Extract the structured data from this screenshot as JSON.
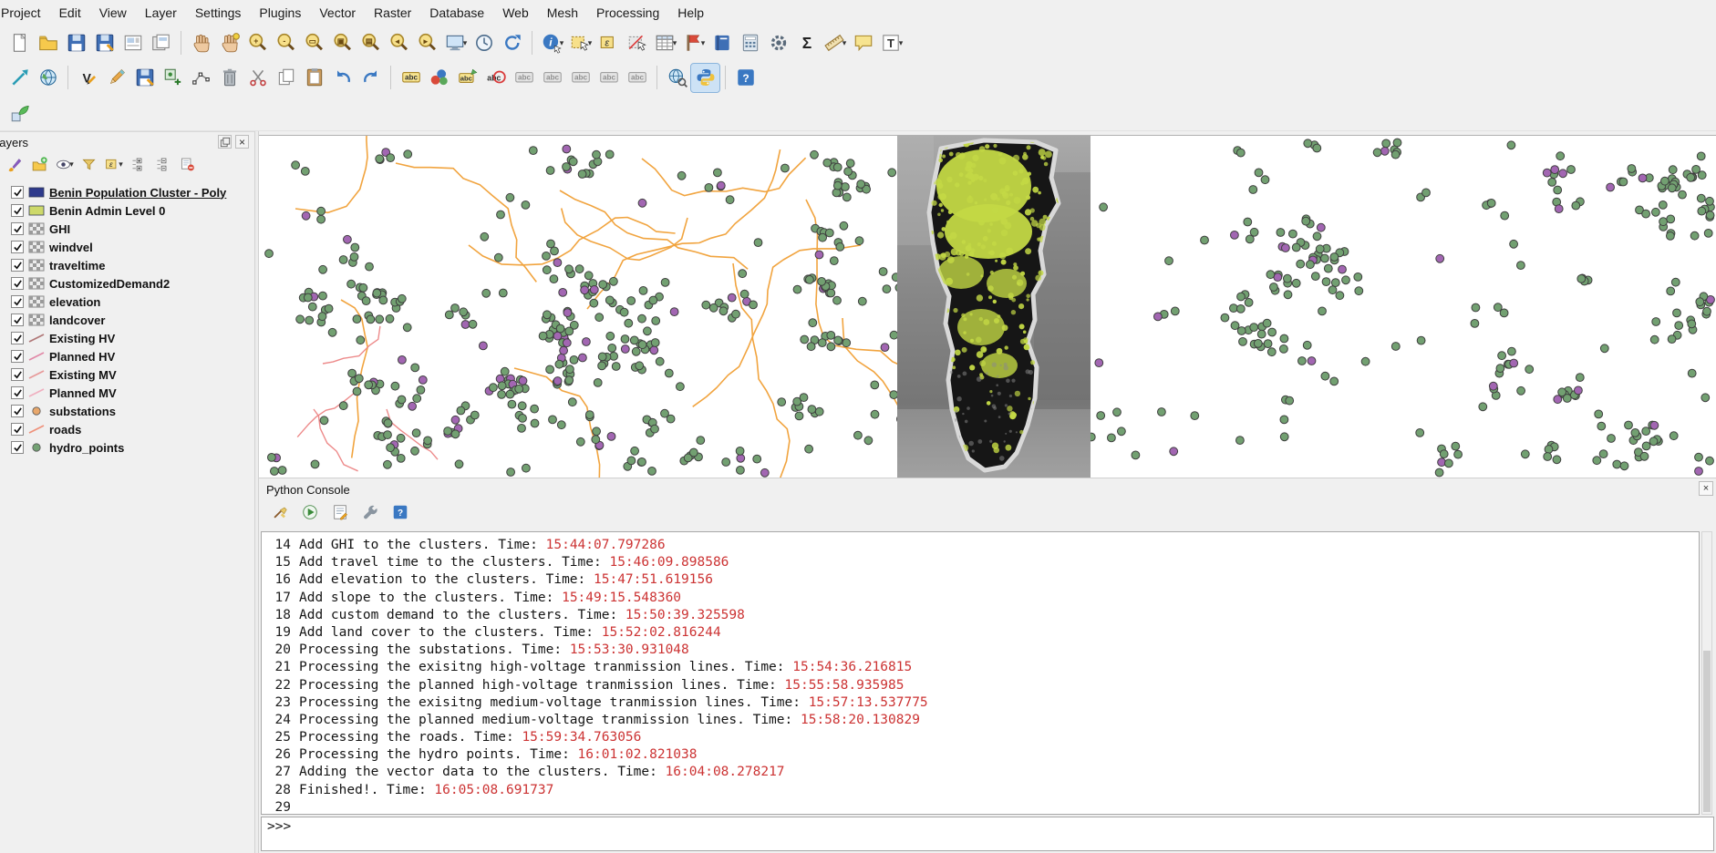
{
  "menu": {
    "items": [
      "Project",
      "Edit",
      "View",
      "Layer",
      "Settings",
      "Plugins",
      "Vector",
      "Raster",
      "Database",
      "Web",
      "Mesh",
      "Processing",
      "Help"
    ]
  },
  "icons": {
    "dropdown": "▾",
    "close": "×",
    "check": "✓"
  },
  "toolbar_main": [
    {
      "name": "new-project",
      "kind": "page"
    },
    {
      "name": "open-project",
      "kind": "folder"
    },
    {
      "name": "save-project",
      "kind": "floppy"
    },
    {
      "name": "save-project-as",
      "kind": "floppy2"
    },
    {
      "name": "new-print-layout",
      "kind": "layout"
    },
    {
      "name": "layout-manager",
      "kind": "layoutmgr"
    },
    {
      "sep": true
    },
    {
      "name": "pan-map",
      "kind": "hand"
    },
    {
      "name": "pan-to-selection",
      "kind": "hand2"
    },
    {
      "name": "zoom-in",
      "kind": "zoom:+"
    },
    {
      "name": "zoom-out",
      "kind": "zoom:-"
    },
    {
      "name": "zoom-full",
      "kind": "zoom:▭"
    },
    {
      "name": "zoom-to-selection",
      "kind": "zoom:▣"
    },
    {
      "name": "zoom-to-layer",
      "kind": "zoom:▤"
    },
    {
      "name": "zoom-last",
      "kind": "zoom:◂"
    },
    {
      "name": "zoom-next",
      "kind": "zoom:▸"
    },
    {
      "name": "new-map-view",
      "kind": "monitor",
      "arrow": true
    },
    {
      "name": "temporal-controller",
      "kind": "clock"
    },
    {
      "name": "refresh-map",
      "kind": "refresh"
    },
    {
      "sep": true
    },
    {
      "name": "identify-features",
      "kind": "info",
      "arrow": true
    },
    {
      "name": "select-features",
      "kind": "cursorbox",
      "arrow": true
    },
    {
      "name": "select-by-expression",
      "kind": "epsilon"
    },
    {
      "name": "deselect-features",
      "kind": "deselect"
    },
    {
      "name": "open-attribute-table",
      "kind": "table",
      "arrow": true
    },
    {
      "name": "new-spatial-bookmark",
      "kind": "flag",
      "arrow": true
    },
    {
      "name": "show-bookmarks",
      "kind": "book"
    },
    {
      "name": "field-calculator",
      "kind": "calc"
    },
    {
      "name": "processing-toolbox",
      "kind": "gear"
    },
    {
      "name": "statistics-summary",
      "kind": "sigma"
    },
    {
      "name": "measure",
      "kind": "ruler",
      "arrow": true
    },
    {
      "name": "map-tips",
      "kind": "bubble"
    },
    {
      "name": "text-annotation",
      "kind": "textT",
      "arrow": true
    }
  ],
  "toolbar_digitizing": [
    {
      "name": "move-feature",
      "kind": "move"
    },
    {
      "name": "georeferencer",
      "kind": "globe"
    },
    {
      "sep": true
    },
    {
      "name": "current-edits",
      "kind": "vpencil"
    },
    {
      "name": "toggle-editing",
      "kind": "pencil"
    },
    {
      "name": "save-layer-edits",
      "kind": "floppy2"
    },
    {
      "name": "add-feature",
      "kind": "addfeat"
    },
    {
      "name": "vertex-tool",
      "kind": "vertex"
    },
    {
      "name": "delete-selected",
      "kind": "trash"
    },
    {
      "name": "split-features",
      "kind": "scissors"
    },
    {
      "name": "copy-features",
      "kind": "copy"
    },
    {
      "name": "paste-features",
      "kind": "paste"
    },
    {
      "name": "undo",
      "kind": "undo"
    },
    {
      "name": "redo",
      "kind": "redo"
    },
    {
      "sep": true
    },
    {
      "name": "layer-labeling-options",
      "kind": "abc"
    },
    {
      "name": "layer-diagram-options",
      "kind": "diagram"
    },
    {
      "name": "pin-unpin-labels",
      "kind": "abcpin"
    },
    {
      "name": "highlight-pinned-labels",
      "kind": "abcred"
    },
    {
      "name": "move-label",
      "kind": "abcgray"
    },
    {
      "name": "rotate-label",
      "kind": "abcgray"
    },
    {
      "name": "change-label-properties",
      "kind": "abcgray"
    },
    {
      "name": "show-hide-labels",
      "kind": "abcgray"
    },
    {
      "name": "label-toolbar-extra",
      "kind": "abcgray"
    },
    {
      "sep": true
    },
    {
      "name": "metasearch",
      "kind": "globe2"
    },
    {
      "name": "python-console",
      "kind": "python",
      "active": true
    },
    {
      "sep": true
    },
    {
      "name": "help-contents",
      "kind": "question"
    }
  ],
  "toolbar_plugins": [
    {
      "name": "plugin-tool",
      "kind": "plugin"
    }
  ],
  "layers_panel": {
    "title": "Layers",
    "toolbar": [
      {
        "name": "open-layer-styling",
        "kind": "brush"
      },
      {
        "name": "add-group",
        "kind": "addgroup"
      },
      {
        "name": "manage-map-themes",
        "kind": "eye",
        "arrow": true
      },
      {
        "name": "filter-legend",
        "kind": "funnel"
      },
      {
        "name": "filter-by-expression",
        "kind": "epsilon",
        "arrow": true
      },
      {
        "name": "expand-all",
        "kind": "expand"
      },
      {
        "name": "collapse-all",
        "kind": "collapse"
      },
      {
        "name": "remove-layer",
        "kind": "removelayer"
      }
    ],
    "items": [
      {
        "label": "Benin Population Cluster - Poly",
        "type": "poly",
        "color": "#2e3a8c",
        "checked": true,
        "selected": true
      },
      {
        "label": "Benin Admin Level 0",
        "type": "fill",
        "color": "#cdd96a",
        "checked": true
      },
      {
        "label": "GHI",
        "type": "raster",
        "checked": true
      },
      {
        "label": "windvel",
        "type": "raster",
        "checked": true
      },
      {
        "label": "traveltime",
        "type": "raster",
        "checked": true
      },
      {
        "label": "CustomizedDemand2",
        "type": "raster",
        "checked": true
      },
      {
        "label": "elevation",
        "type": "raster",
        "checked": true
      },
      {
        "label": "landcover",
        "type": "raster",
        "checked": true
      },
      {
        "label": "Existing HV",
        "type": "line",
        "color": "#b07878",
        "checked": true
      },
      {
        "label": "Planned HV",
        "type": "line",
        "color": "#e18aa8",
        "checked": true
      },
      {
        "label": "Existing MV",
        "type": "line",
        "color": "#e79a9a",
        "checked": true
      },
      {
        "label": "Planned MV",
        "type": "line",
        "color": "#f0b0c0",
        "checked": true
      },
      {
        "label": "substations",
        "type": "point",
        "color": "#e8a76b",
        "checked": true
      },
      {
        "label": "roads",
        "type": "line",
        "color": "#ef927b",
        "checked": true
      },
      {
        "label": "hydro_points",
        "type": "point",
        "color": "#74a274",
        "checked": true
      }
    ]
  },
  "map": {
    "background": "#ffffff",
    "green_dot": "#72a071",
    "purple_dot": "#a266b2",
    "dot_outline": "#3f3f3f",
    "road_color": "#f1a43f",
    "hv_line_color": "#ed8a8a",
    "raster_strip": {
      "bg_top": "#a9a9a9",
      "bg_mid": "#888888",
      "bg_bottom": "#979797",
      "country_fill": "#161616",
      "country_glow": "#d9d9d9",
      "veg_color": "#c3d845"
    }
  },
  "console": {
    "title": "Python Console",
    "prompt": ">>>",
    "time_color": "#cc3333",
    "toolbar": [
      {
        "name": "clear-console",
        "kind": "broom"
      },
      {
        "name": "run-command",
        "kind": "run"
      },
      {
        "name": "show-editor",
        "kind": "notepad"
      },
      {
        "name": "console-options",
        "kind": "wrench"
      },
      {
        "name": "console-help",
        "kind": "question"
      }
    ],
    "lines": [
      {
        "num": "14",
        "text": "Add GHI to the clusters. Time: ",
        "time": "15:44:07.797286"
      },
      {
        "num": "15",
        "text": "Add travel time to the clusters. Time: ",
        "time": "15:46:09.898586"
      },
      {
        "num": "16",
        "text": "Add elevation to the clusters. Time: ",
        "time": "15:47:51.619156"
      },
      {
        "num": "17",
        "text": "Add slope to the clusters. Time: ",
        "time": "15:49:15.548360"
      },
      {
        "num": "18",
        "text": "Add custom demand to the clusters. Time: ",
        "time": "15:50:39.325598"
      },
      {
        "num": "19",
        "text": "Add land cover to the clusters. Time: ",
        "time": "15:52:02.816244"
      },
      {
        "num": "20",
        "text": "Processing the substations. Time: ",
        "time": "15:53:30.931048"
      },
      {
        "num": "21",
        "text": "Processing the exisitng high-voltage tranmission lines. Time: ",
        "time": "15:54:36.216815"
      },
      {
        "num": "22",
        "text": "Processing the planned high-voltage tranmission lines. Time: ",
        "time": "15:55:58.935985"
      },
      {
        "num": "23",
        "text": "Processing the exisitng medium-voltage tranmission lines. Time: ",
        "time": "15:57:13.537775"
      },
      {
        "num": "24",
        "text": "Processing the planned medium-voltage tranmission lines. Time: ",
        "time": "15:58:20.130829"
      },
      {
        "num": "25",
        "text": "Processing the roads. Time: ",
        "time": "15:59:34.763056"
      },
      {
        "num": "26",
        "text": "Processing the hydro points. Time: ",
        "time": "16:01:02.821038"
      },
      {
        "num": "27",
        "text": "Adding the vector data to the clusters. Time: ",
        "time": "16:04:08.278217"
      },
      {
        "num": "28",
        "text": "Finished!. Time: ",
        "time": "16:05:08.691737"
      },
      {
        "num": "29",
        "text": "",
        "time": ""
      }
    ]
  }
}
